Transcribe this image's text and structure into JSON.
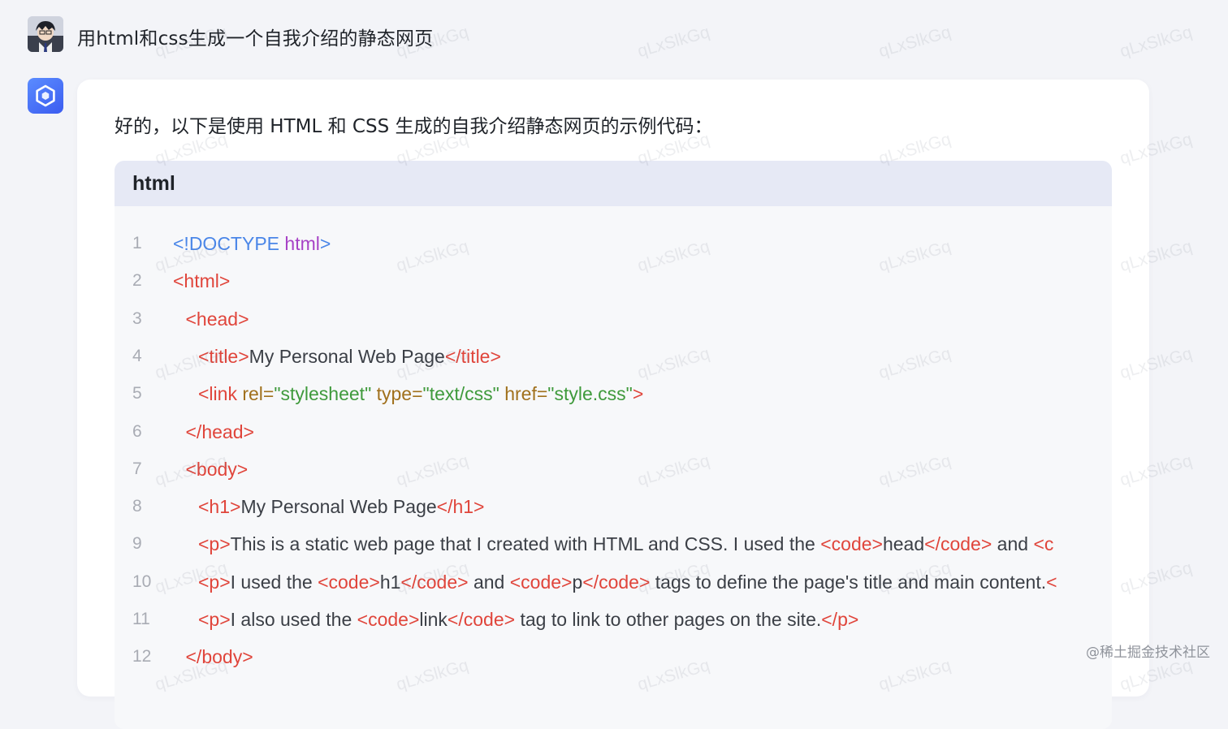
{
  "chat": {
    "user_message": "用html和css生成一个自我介绍的静态网页",
    "bot_intro": "好的，以下是使用 HTML 和 CSS 生成的自我介绍静态网页的示例代码："
  },
  "code_block": {
    "language": "html",
    "lines": [
      {
        "n": "1",
        "indent": 0,
        "tokens": [
          {
            "t": "<!DOCTYPE ",
            "c": "doc"
          },
          {
            "t": "html",
            "c": "docname"
          },
          {
            "t": ">",
            "c": "doc"
          }
        ]
      },
      {
        "n": "2",
        "indent": 0,
        "tokens": [
          {
            "t": "<html>",
            "c": "tag"
          }
        ]
      },
      {
        "n": "3",
        "indent": 1,
        "tokens": [
          {
            "t": "<head>",
            "c": "tag"
          }
        ]
      },
      {
        "n": "4",
        "indent": 2,
        "tokens": [
          {
            "t": "<title>",
            "c": "tag"
          },
          {
            "t": "My Personal Web Page",
            "c": "text"
          },
          {
            "t": "</title>",
            "c": "tag"
          }
        ]
      },
      {
        "n": "5",
        "indent": 2,
        "tokens": [
          {
            "t": "<link ",
            "c": "tag"
          },
          {
            "t": "rel=",
            "c": "attr"
          },
          {
            "t": "\"stylesheet\"",
            "c": "str"
          },
          {
            "t": " ",
            "c": "text"
          },
          {
            "t": "type=",
            "c": "attr"
          },
          {
            "t": "\"text/css\"",
            "c": "str"
          },
          {
            "t": " ",
            "c": "text"
          },
          {
            "t": "href=",
            "c": "attr"
          },
          {
            "t": "\"style.css\"",
            "c": "str"
          },
          {
            "t": ">",
            "c": "tag"
          }
        ]
      },
      {
        "n": "6",
        "indent": 1,
        "tokens": [
          {
            "t": "</head>",
            "c": "tag"
          }
        ]
      },
      {
        "n": "7",
        "indent": 1,
        "tokens": [
          {
            "t": "<body>",
            "c": "tag"
          }
        ]
      },
      {
        "n": "8",
        "indent": 2,
        "tokens": [
          {
            "t": "<h1>",
            "c": "tag"
          },
          {
            "t": "My Personal Web Page",
            "c": "text"
          },
          {
            "t": "</h1>",
            "c": "tag"
          }
        ]
      },
      {
        "n": "9",
        "indent": 2,
        "tokens": [
          {
            "t": "<p>",
            "c": "tag"
          },
          {
            "t": "This is a static web page that I created with HTML and CSS. I used the ",
            "c": "text"
          },
          {
            "t": "<code>",
            "c": "tag"
          },
          {
            "t": "head",
            "c": "text"
          },
          {
            "t": "</code>",
            "c": "tag"
          },
          {
            "t": " and ",
            "c": "text"
          },
          {
            "t": "<c",
            "c": "tag"
          }
        ]
      },
      {
        "n": "10",
        "indent": 2,
        "tokens": [
          {
            "t": "<p>",
            "c": "tag"
          },
          {
            "t": "I used the ",
            "c": "text"
          },
          {
            "t": "<code>",
            "c": "tag"
          },
          {
            "t": "h1",
            "c": "text"
          },
          {
            "t": "</code>",
            "c": "tag"
          },
          {
            "t": " and ",
            "c": "text"
          },
          {
            "t": "<code>",
            "c": "tag"
          },
          {
            "t": "p",
            "c": "text"
          },
          {
            "t": "</code>",
            "c": "tag"
          },
          {
            "t": " tags to define the page's title and main content.",
            "c": "text"
          },
          {
            "t": "<",
            "c": "tag"
          }
        ]
      },
      {
        "n": "11",
        "indent": 2,
        "tokens": [
          {
            "t": "<p>",
            "c": "tag"
          },
          {
            "t": "I also used the ",
            "c": "text"
          },
          {
            "t": "<code>",
            "c": "tag"
          },
          {
            "t": "link",
            "c": "text"
          },
          {
            "t": "</code>",
            "c": "tag"
          },
          {
            "t": " tag to link to other pages on the site.",
            "c": "text"
          },
          {
            "t": "</p>",
            "c": "tag"
          }
        ]
      },
      {
        "n": "12",
        "indent": 1,
        "tokens": [
          {
            "t": "</body>",
            "c": "tag"
          }
        ]
      }
    ]
  },
  "watermark": {
    "text": "qLxSlkGq"
  },
  "footer": {
    "credit": "@稀土掘金技术社区"
  },
  "colors": {
    "tag": "#e0453b",
    "doctype": "#4a86e8",
    "doctype_name": "#a742c6",
    "attr": "#a0701c",
    "string": "#3f9a3c",
    "text": "#3b3f46",
    "bot_avatar": "#4a6cf7"
  },
  "icons": {
    "user_avatar": "anime-avatar-icon",
    "bot_avatar": "hexagon-logo-icon"
  }
}
